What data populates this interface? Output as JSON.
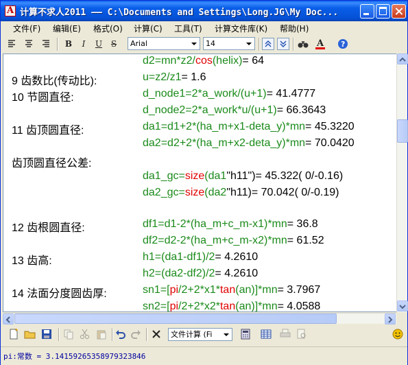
{
  "window": {
    "title": "计算不求人2011 —— C:\\Documents and Settings\\Long.JG\\My Doc..."
  },
  "menu": {
    "items": [
      "文件(F)",
      "编辑(E)",
      "格式(O)",
      "计算(C)",
      "工具(T)",
      "计算文件库(K)",
      "帮助(H)"
    ]
  },
  "toolbar": {
    "font_name": "Arial",
    "font_size": "14",
    "bold_label": "B",
    "italic_label": "I",
    "underline_label": "U",
    "strike_label": "S"
  },
  "editor": {
    "lines": [
      {
        "label": "",
        "formula": [
          {
            "t": "d2=mn*z2/",
            "c": "g"
          },
          {
            "t": "cos",
            "c": "r"
          },
          {
            "t": "(helix)",
            "c": "g"
          },
          {
            "t": "= 64",
            "c": "k"
          }
        ]
      },
      {
        "label": "9 齿数比(传动比):",
        "formula": [
          {
            "t": "u=z2/z1",
            "c": "g"
          },
          {
            "t": "= 1.6",
            "c": "k"
          }
        ]
      },
      {
        "label": "10 节圆直径:",
        "formula": [
          {
            "t": "d_node1=2*a_work/(u+1)",
            "c": "g"
          },
          {
            "t": "= 41.4777",
            "c": "k"
          }
        ]
      },
      {
        "label": "",
        "formula": [
          {
            "t": "d_node2=2*a_work*u/(u+1)",
            "c": "g"
          },
          {
            "t": "= 66.3643",
            "c": "k"
          }
        ]
      },
      {
        "label": "11 齿顶圆直径:",
        "formula": [
          {
            "t": "da1=d1+2*(ha_m+x1-deta_y)*mn",
            "c": "g"
          },
          {
            "t": "= 45.3220",
            "c": "k"
          }
        ]
      },
      {
        "label": "",
        "formula": [
          {
            "t": "da2=d2+2*(ha_m+x2-deta_y)*mn",
            "c": "g"
          },
          {
            "t": "= 70.0420",
            "c": "k"
          }
        ]
      },
      {
        "label": "齿顶圆直径公差:",
        "formula": []
      },
      {
        "label": "",
        "formula": [
          {
            "t": "da1_gc=",
            "c": "g"
          },
          {
            "t": "size",
            "c": "r"
          },
          {
            "t": "(da1",
            "c": "g"
          },
          {
            "t": "\"h11\")",
            "c": "k"
          },
          {
            "t": "= 45.322( 0/-0.16)",
            "c": "k"
          }
        ]
      },
      {
        "label": "",
        "formula": [
          {
            "t": "da2_gc=",
            "c": "g"
          },
          {
            "t": "size",
            "c": "r"
          },
          {
            "t": "(da2",
            "c": "g"
          },
          {
            "t": "\"h11)",
            "c": "k"
          },
          {
            "t": "= 70.042( 0/-0.19)",
            "c": "k"
          }
        ]
      },
      {
        "label": "12 齿根圆直径:",
        "formula": [
          {
            "t": "df1=d1-2*(ha_m+c_m-x1)*mn",
            "c": "g"
          },
          {
            "t": "= 36.8",
            "c": "k"
          }
        ]
      },
      {
        "label": "",
        "formula": [
          {
            "t": "df2=d2-2*(ha_m+c_m-x2)*mn",
            "c": "g"
          },
          {
            "t": "= 61.52",
            "c": "k"
          }
        ]
      },
      {
        "label": "13 齿高:",
        "formula": [
          {
            "t": "h1=(da1-df1)/2",
            "c": "g"
          },
          {
            "t": "= 4.2610",
            "c": "k"
          }
        ]
      },
      {
        "label": "",
        "formula": [
          {
            "t": "h2=(da2-df2)/2",
            "c": "g"
          },
          {
            "t": "= 4.2610",
            "c": "k"
          }
        ]
      },
      {
        "label": "14 法面分度圆齿厚:",
        "formula": [
          {
            "t": "sn1=[",
            "c": "g"
          },
          {
            "t": "pi",
            "c": "r"
          },
          {
            "t": "/2+2*x1*",
            "c": "g"
          },
          {
            "t": "tan",
            "c": "r"
          },
          {
            "t": "(an)]*mn",
            "c": "g"
          },
          {
            "t": "= 3.7967",
            "c": "k"
          }
        ]
      },
      {
        "label": "",
        "formula": [
          {
            "t": "sn2=[",
            "c": "g"
          },
          {
            "t": "pi",
            "c": "r"
          },
          {
            "t": "/2+2*x2*",
            "c": "g"
          },
          {
            "t": "tan",
            "c": "r"
          },
          {
            "t": "(an)]*mn",
            "c": "g"
          },
          {
            "t": "= 4.0588",
            "c": "k"
          }
        ]
      }
    ]
  },
  "bottom_toolbar": {
    "mode_select": "文件计算 (Fi"
  },
  "status": {
    "text": "pi:常数 = 3.14159265358979323846"
  },
  "colors": {
    "formula": "#1a8a1a",
    "function": "#e00000",
    "titlebar": "#0a5ee8"
  }
}
